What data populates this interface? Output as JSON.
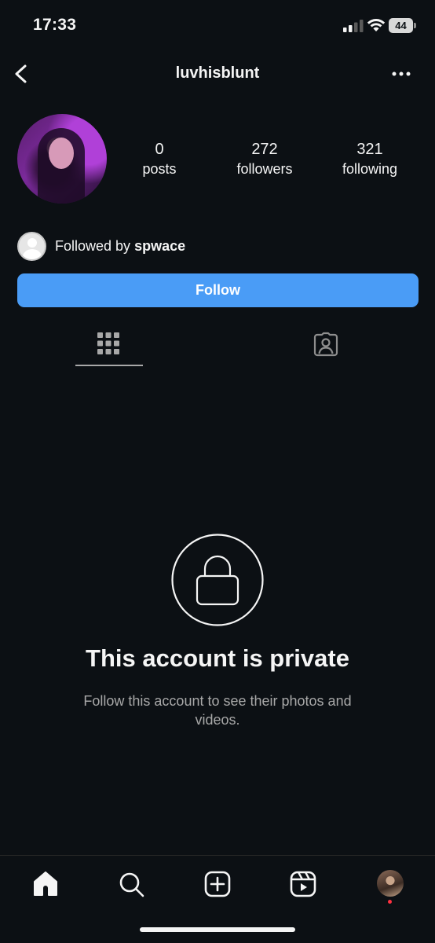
{
  "status_bar": {
    "time": "17:33",
    "battery": "44",
    "icons": [
      "cellular-signal-icon",
      "wifi-icon",
      "battery-icon"
    ]
  },
  "nav": {
    "username": "luvhisblunt",
    "back_icon": "chevron-left-icon",
    "more_icon": "more-horizontal-icon"
  },
  "profile": {
    "stats": [
      {
        "value": "0",
        "label": "posts"
      },
      {
        "value": "272",
        "label": "followers"
      },
      {
        "value": "321",
        "label": "following"
      }
    ],
    "followed_by_prefix": "Followed by",
    "followed_by_user": "spwace",
    "follow_label": "Follow"
  },
  "tabs": [
    {
      "name": "grid",
      "icon": "grid-icon",
      "active": true
    },
    {
      "name": "tagged",
      "icon": "tagged-person-icon",
      "active": false
    }
  ],
  "private": {
    "title": "This account is private",
    "subtitle": "Follow this account to see their photos and videos.",
    "icon": "lock-icon"
  },
  "bottom_nav": [
    {
      "name": "home",
      "icon": "home-icon"
    },
    {
      "name": "search",
      "icon": "search-icon"
    },
    {
      "name": "create",
      "icon": "plus-square-icon"
    },
    {
      "name": "reels",
      "icon": "reels-icon"
    },
    {
      "name": "profile",
      "icon": "profile-avatar"
    }
  ],
  "colors": {
    "background": "#0c1014",
    "follow_button": "#4a9cf6",
    "text_primary": "#f5f5f5",
    "text_secondary": "#a8a8a8",
    "notification_dot": "#ff3040"
  }
}
